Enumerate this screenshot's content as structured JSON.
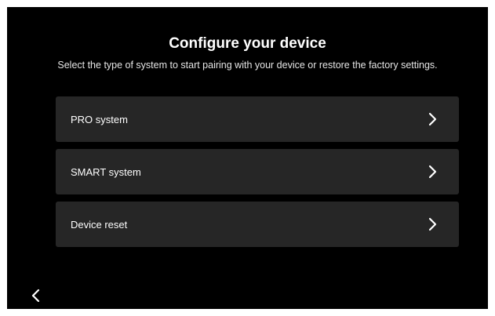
{
  "header": {
    "title": "Configure your device",
    "subtitle": "Select the type of system to start pairing with your device or restore the factory settings."
  },
  "options": [
    {
      "label": "PRO system",
      "icon": "chevron-right-icon"
    },
    {
      "label": "SMART system",
      "icon": "chevron-right-icon"
    },
    {
      "label": "Device reset",
      "icon": "chevron-right-icon"
    }
  ],
  "footer": {
    "back_icon": "chevron-left-icon"
  },
  "colors": {
    "background": "#000000",
    "card": "#262626",
    "text": "#ffffff"
  }
}
